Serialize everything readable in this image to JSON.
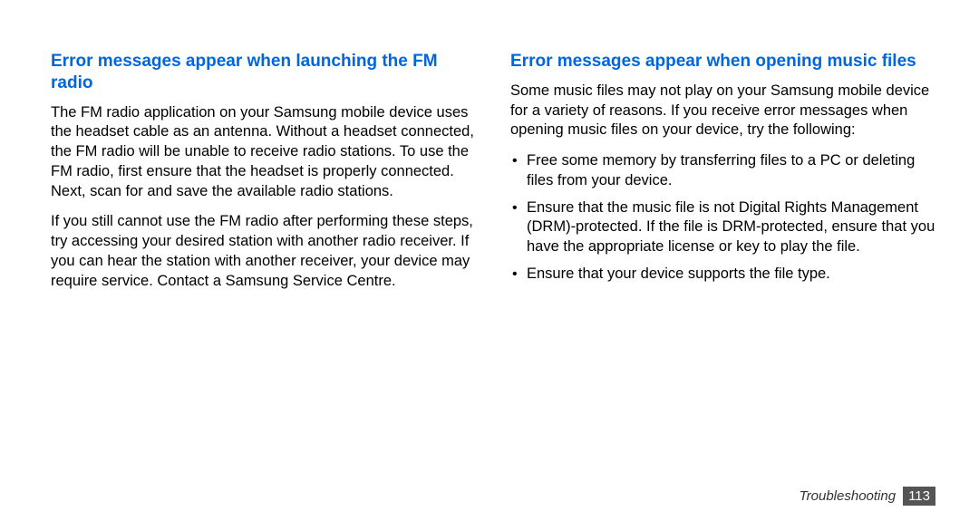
{
  "left": {
    "heading": "Error messages appear when launching the FM radio",
    "para1": "The FM radio application on your Samsung mobile device uses the headset cable as an antenna. Without a headset connected, the FM radio will be unable to receive radio stations. To use the FM radio, first ensure that the headset is properly connected. Next, scan for and save the available radio stations.",
    "para2": "If you still cannot use the FM radio after performing these steps, try accessing your desired station with another radio receiver. If you can hear the station with another receiver, your device may require service. Contact a Samsung Service Centre."
  },
  "right": {
    "heading": "Error messages appear when opening music files",
    "intro": "Some music files may not play on your Samsung mobile device for a variety of reasons. If you receive error messages when opening music files on your device, try the following:",
    "bullets": [
      "Free some memory by transferring files to a PC or deleting files from your device.",
      "Ensure that the music file is not Digital Rights Management (DRM)-protected. If the file is DRM-protected, ensure that you have the appropriate license or key to play the file.",
      "Ensure that your device supports the file type."
    ]
  },
  "footer": {
    "section": "Troubleshooting",
    "page": "113"
  }
}
